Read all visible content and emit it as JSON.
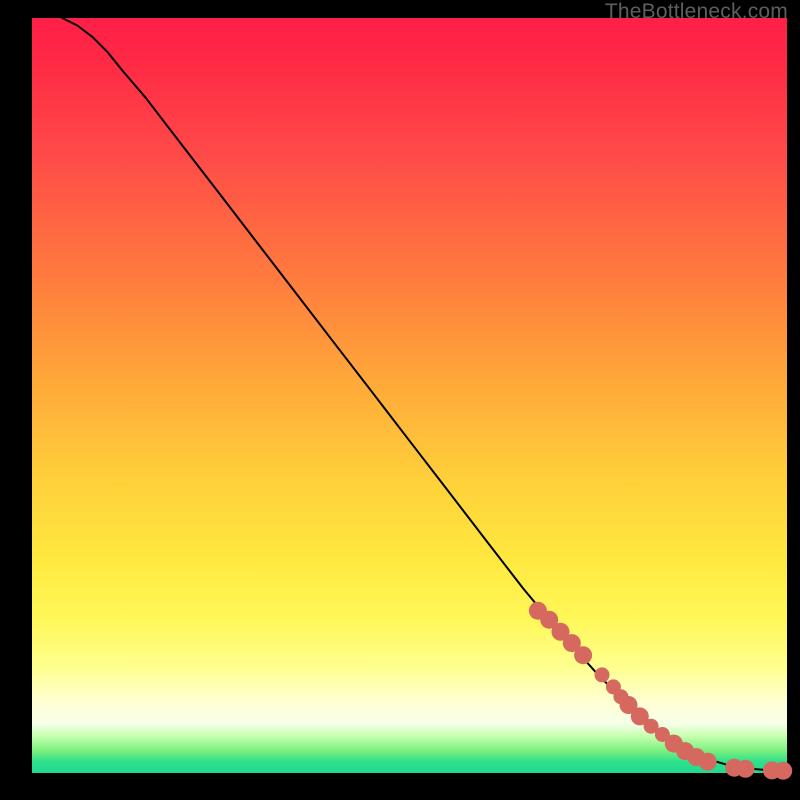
{
  "watermark": "TheBottleneck.com",
  "chart_data": {
    "type": "line",
    "title": "",
    "xlabel": "",
    "ylabel": "",
    "xlim": [
      0,
      100
    ],
    "ylim": [
      0,
      100
    ],
    "grid": false,
    "legend": false,
    "series": [
      {
        "name": "curve",
        "style": "line",
        "color": "#000000",
        "x": [
          4,
          6,
          8,
          10,
          12,
          15,
          20,
          25,
          30,
          35,
          40,
          45,
          50,
          55,
          60,
          65,
          70,
          75,
          80,
          82,
          84,
          86,
          88,
          90,
          92,
          94,
          96,
          98,
          99
        ],
        "y": [
          100,
          99,
          97.5,
          95.5,
          93,
          89.5,
          83,
          76.5,
          70,
          63.5,
          57,
          50.5,
          44,
          37.5,
          31,
          24.5,
          18.5,
          13,
          8,
          6.3,
          4.8,
          3.5,
          2.5,
          1.7,
          1.1,
          0.7,
          0.5,
          0.35,
          0.3
        ]
      },
      {
        "name": "dots",
        "style": "points",
        "color": "#d5695f",
        "radius_small": 7.5,
        "radius_large": 9,
        "points": [
          {
            "x": 67,
            "y": 21.5,
            "r": "large"
          },
          {
            "x": 68.5,
            "y": 20.3,
            "r": "large"
          },
          {
            "x": 70,
            "y": 18.7,
            "r": "large"
          },
          {
            "x": 71.5,
            "y": 17.2,
            "r": "large"
          },
          {
            "x": 73,
            "y": 15.6,
            "r": "large"
          },
          {
            "x": 75.5,
            "y": 13.0,
            "r": "small"
          },
          {
            "x": 77,
            "y": 11.4,
            "r": "small"
          },
          {
            "x": 78,
            "y": 10.1,
            "r": "small"
          },
          {
            "x": 79,
            "y": 9.0,
            "r": "large"
          },
          {
            "x": 80.5,
            "y": 7.5,
            "r": "large"
          },
          {
            "x": 82,
            "y": 6.2,
            "r": "small"
          },
          {
            "x": 83.5,
            "y": 5.1,
            "r": "small"
          },
          {
            "x": 85,
            "y": 3.9,
            "r": "large"
          },
          {
            "x": 86.5,
            "y": 2.9,
            "r": "large"
          },
          {
            "x": 88,
            "y": 2.1,
            "r": "large"
          },
          {
            "x": 89.5,
            "y": 1.5,
            "r": "large"
          },
          {
            "x": 93,
            "y": 0.7,
            "r": "large"
          },
          {
            "x": 94.5,
            "y": 0.55,
            "r": "large"
          },
          {
            "x": 98,
            "y": 0.35,
            "r": "large"
          },
          {
            "x": 99.5,
            "y": 0.3,
            "r": "large"
          }
        ]
      }
    ]
  }
}
